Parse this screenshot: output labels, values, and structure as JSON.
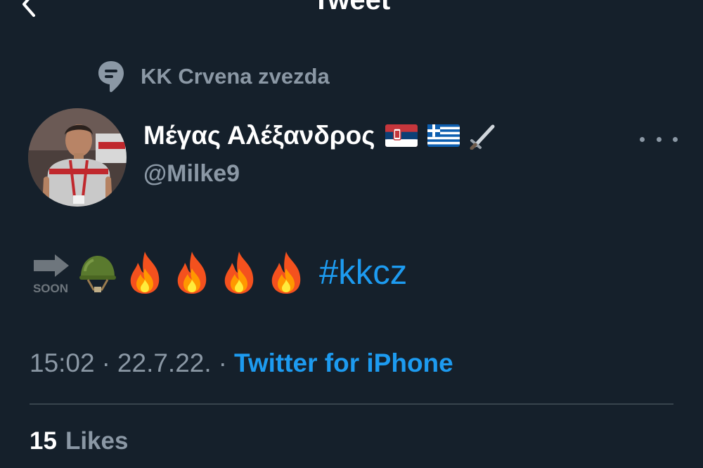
{
  "header": {
    "title": "Tweet",
    "back_icon": "chevron-left-icon"
  },
  "social_context": {
    "icon": "topic-icon",
    "label": "KK Crvena zvezda"
  },
  "author": {
    "display_name": "Μέγας Αλέξανδρος",
    "name_emojis": [
      "flag-serbia",
      "flag-greece",
      "dagger"
    ],
    "handle": "@Milke9",
    "avatar": "avatar-photo"
  },
  "tweet": {
    "emojis": [
      "soon-arrow",
      "military-helmet",
      "fire",
      "fire",
      "fire",
      "fire"
    ],
    "hashtag": "#kkcz"
  },
  "meta": {
    "time": "15:02",
    "separator": "·",
    "date": "22.7.22.",
    "source": "Twitter for iPhone"
  },
  "stats": {
    "likes_count": "15",
    "likes_label": "Likes"
  },
  "colors": {
    "background": "#15202b",
    "accent": "#1d9bf0",
    "secondary_text": "#8b98a5",
    "divider": "#38444d"
  }
}
